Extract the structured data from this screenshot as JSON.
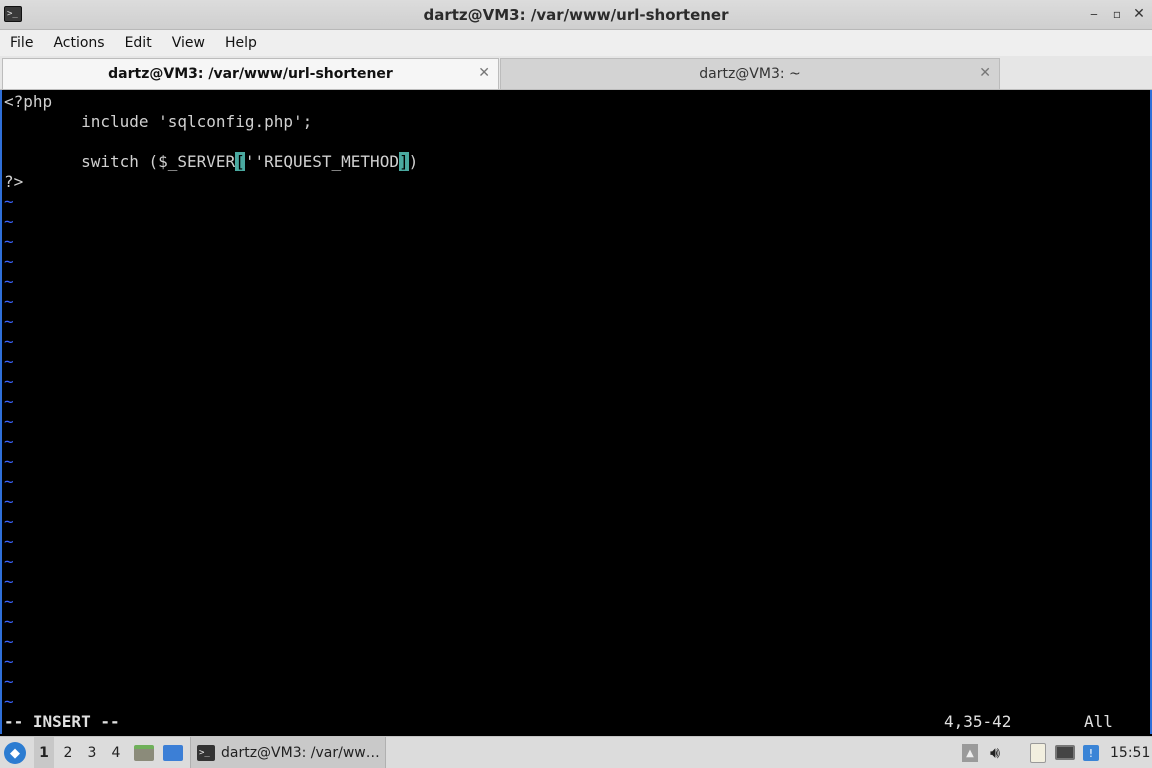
{
  "window": {
    "title": "dartz@VM3: /var/www/url-shortener",
    "app_icon_glyph": ">_",
    "controls": {
      "minimize": "‒",
      "maximize": "▫",
      "close": "✕"
    }
  },
  "menubar": {
    "items": [
      "File",
      "Actions",
      "Edit",
      "View",
      "Help"
    ]
  },
  "tabs": [
    {
      "label": "dartz@VM3: /var/www/url-shortener",
      "active": true,
      "close": "✕"
    },
    {
      "label": "dartz@VM3: ~",
      "active": false,
      "close": "✕"
    }
  ],
  "editor": {
    "line1": "<?php",
    "line2": "        include 'sqlconfig.php';",
    "line3": "",
    "line4_a": "        switch ($_SERVER",
    "line4_b": "[",
    "line4_c": "''REQUEST_METHOD",
    "line4_d": "]",
    "line4_e": ")",
    "line5": "?>",
    "tilde": "~",
    "tilde_count": 26,
    "mode": "-- INSERT --",
    "position": "4,35-42",
    "scroll": "All",
    "colors": {
      "text": "#d0d0d0",
      "tilde": "#3b63ff",
      "cursor_match": "#4aa9a0"
    }
  },
  "taskbar": {
    "start_icon": "start-menu-icon",
    "workspaces": [
      "1",
      "2",
      "3",
      "4"
    ],
    "active_workspace": "1",
    "task_label": "dartz@VM3: /var/ww…",
    "clock": "15:51"
  }
}
